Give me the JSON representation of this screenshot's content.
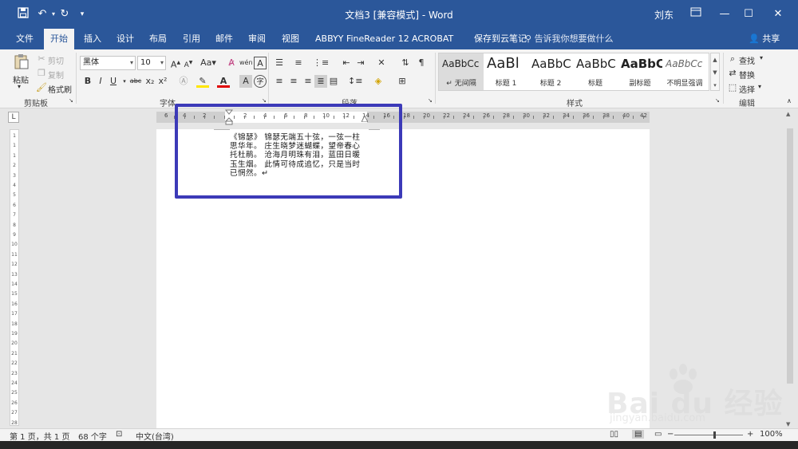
{
  "title_bar": {
    "title": "文档3 [兼容模式] - Word",
    "user": "刘东"
  },
  "tabs": [
    {
      "label": "文件"
    },
    {
      "label": "开始"
    },
    {
      "label": "插入"
    },
    {
      "label": "设计"
    },
    {
      "label": "布局"
    },
    {
      "label": "引用"
    },
    {
      "label": "邮件"
    },
    {
      "label": "审阅"
    },
    {
      "label": "视图"
    },
    {
      "label": "ABBYY FineReader 12"
    },
    {
      "label": "ACROBAT"
    },
    {
      "label": "保存到云笔记"
    }
  ],
  "tell_me": "告诉我你想要做什么",
  "share": "共享",
  "ribbon": {
    "clipboard": {
      "paste": "粘贴",
      "cut": "剪切",
      "copy": "复制",
      "format_painter": "格式刷",
      "label": "剪贴板"
    },
    "font": {
      "font_name": "黑体",
      "font_size": "10",
      "label": "字体"
    },
    "paragraph": {
      "label": "段落"
    },
    "styles": {
      "label": "样式",
      "items": [
        {
          "sample": "AaBbCc",
          "name": "↵ 无间隔"
        },
        {
          "sample": "AaBl",
          "name": "标题 1"
        },
        {
          "sample": "AaBbC",
          "name": "标题 2"
        },
        {
          "sample": "AaBbC",
          "name": "标题"
        },
        {
          "sample": "AaBbC",
          "name": "副标题"
        },
        {
          "sample": "AaBbCc",
          "name": "不明显强调"
        }
      ]
    },
    "editing": {
      "find": "查找",
      "replace": "替换",
      "select": "选择",
      "label": "编辑"
    }
  },
  "ruler": {
    "h_labels": [
      "6",
      "4",
      "2",
      "",
      "2",
      "4",
      "6",
      "8",
      "10",
      "12",
      "14",
      "16",
      "18",
      "20",
      "22",
      "24",
      "26",
      "28",
      "30",
      "32",
      "34",
      "36",
      "38",
      "40",
      "42"
    ],
    "v_labels": [
      "1",
      "1",
      "1",
      "2",
      "3",
      "4",
      "5",
      "6",
      "7",
      "8",
      "9",
      "10",
      "11",
      "12",
      "13",
      "14",
      "15",
      "16",
      "17",
      "18",
      "19",
      "20",
      "21",
      "22",
      "23",
      "24",
      "25",
      "26",
      "27",
      "28"
    ]
  },
  "document": {
    "lines": [
      "《锦瑟》 锦瑟无端五十弦，一弦一柱",
      "思华年。 庄生晓梦迷蝴蝶，望帝春心",
      "托杜鹃。 沧海月明珠有泪，蓝田日暖",
      "玉生烟。 此情可待成追忆，只是当时",
      "已惘然。↵"
    ]
  },
  "status_bar": {
    "page": "第 1 页，共 1 页",
    "words": "68 个字",
    "language": "中文(台湾)",
    "zoom": "100%"
  },
  "watermark": {
    "logo": "Bai  du 经验",
    "url": "jingyan.baidu.com"
  },
  "colors": {
    "accent": "#2b579a",
    "highlight_box": "#3c3ab8"
  }
}
